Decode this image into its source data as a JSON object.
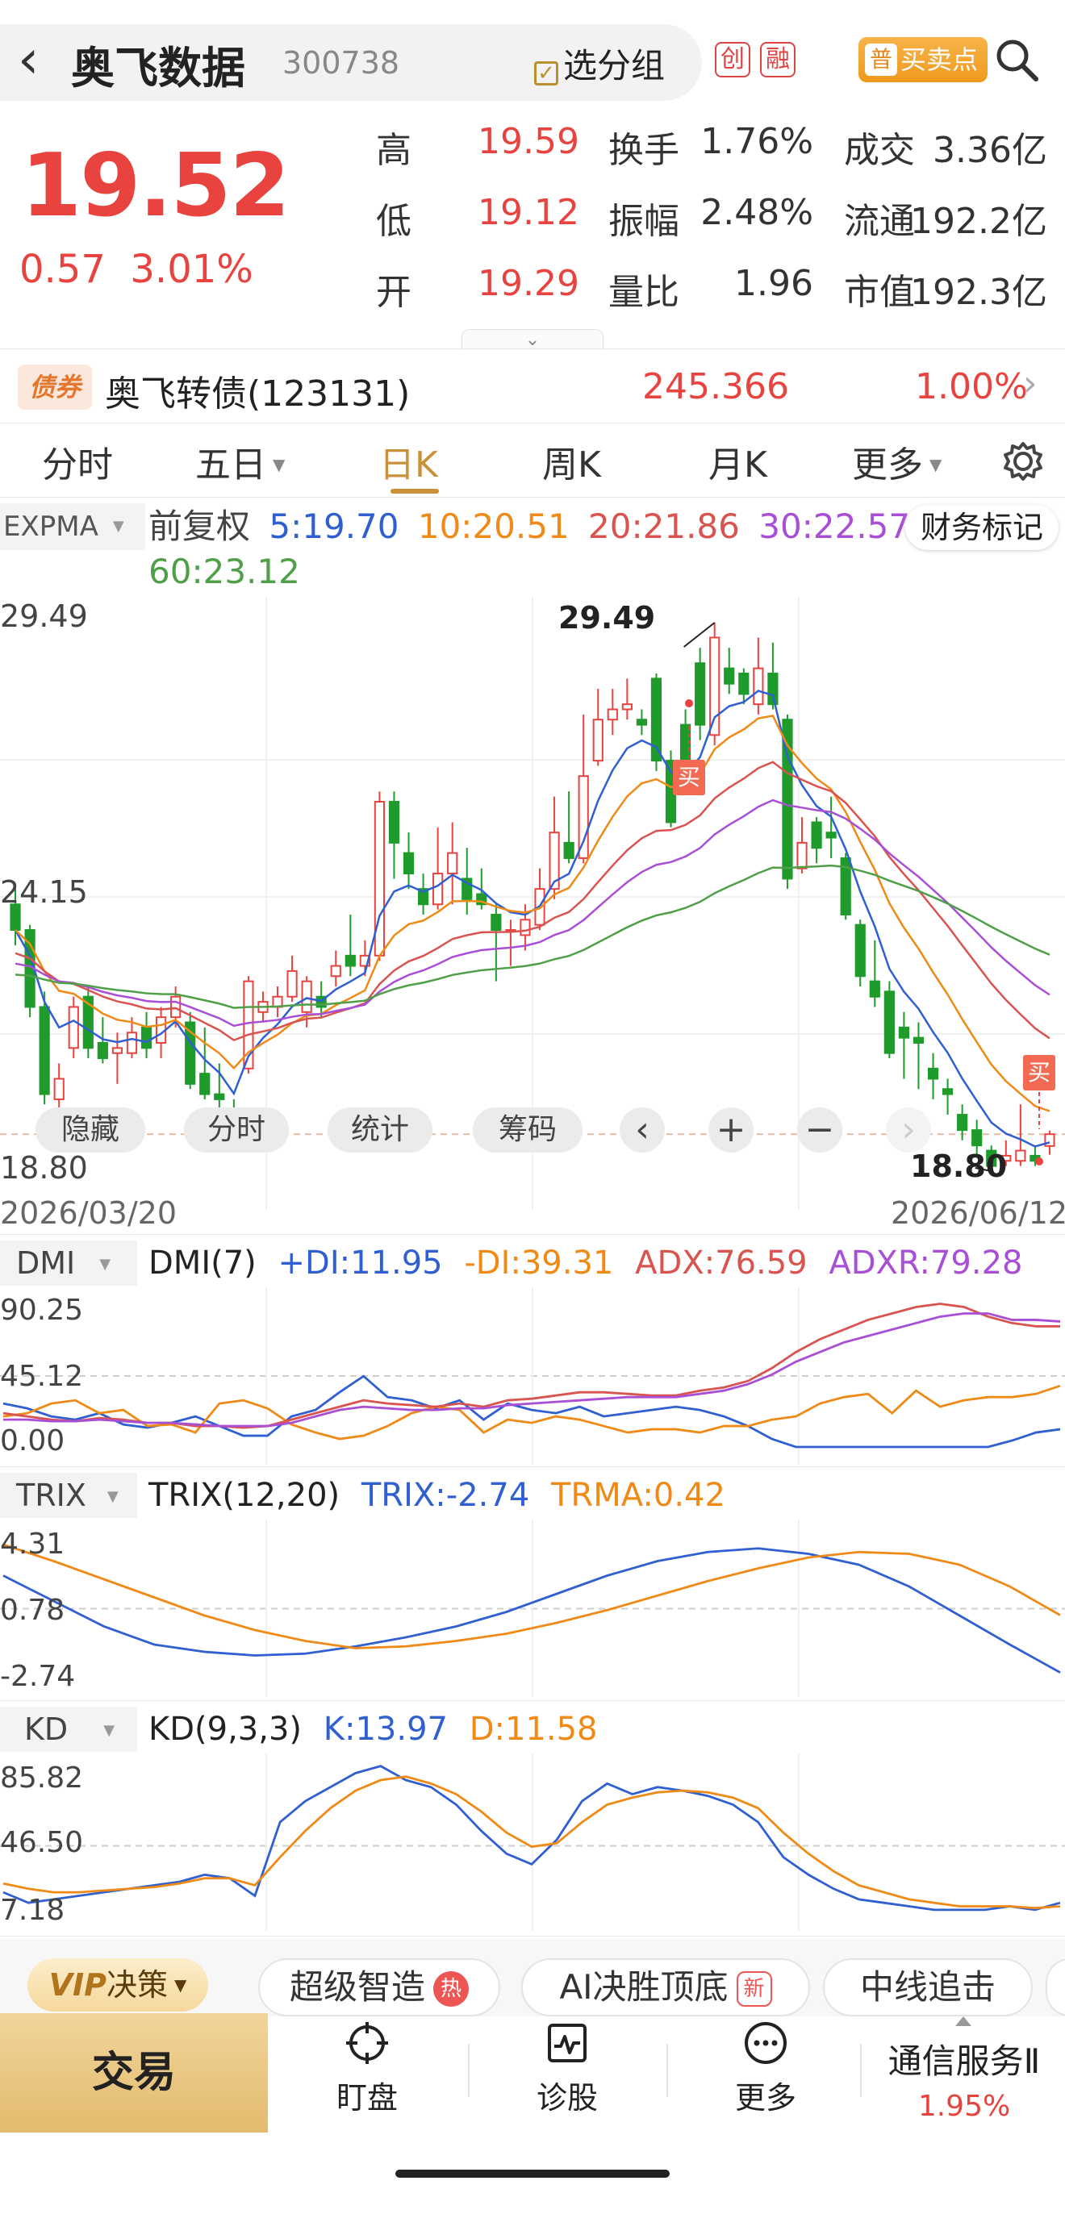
{
  "header": {
    "back": "‹",
    "name": "奥飞数据",
    "code": "300738",
    "group_btn": "选分组",
    "badge_chuang": "创",
    "badge_rong": "融",
    "maimai_tag": "普",
    "maimai": "买卖点"
  },
  "quote": {
    "price": "19.52",
    "change": "0.57",
    "change_pct": "3.01%",
    "rows": [
      {
        "l1": "高",
        "v1": "19.59",
        "l2": "换手",
        "v2": "1.76%",
        "l3": "成交",
        "v3": "3.36亿"
      },
      {
        "l1": "低",
        "v1": "19.12",
        "l2": "振幅",
        "v2": "2.48%",
        "l3": "流通",
        "v3": "192.2亿"
      },
      {
        "l1": "开",
        "v1": "19.29",
        "l2": "量比",
        "v2": "1.96",
        "l3": "市值",
        "v3": "192.3亿"
      }
    ]
  },
  "bond": {
    "tag": "债券",
    "name": "奥飞转债(123131)",
    "price": "245.366",
    "pct": "1.00%"
  },
  "tabs": [
    "分时",
    "五日",
    "日K",
    "周K",
    "月K",
    "更多"
  ],
  "ma": {
    "indicator": "EXPMA",
    "fq": "前复权",
    "m5": "5:19.70",
    "m10": "10:20.51",
    "m20": "20:21.86",
    "m30": "30:22.57",
    "m60": "60:23.12",
    "finance": "财务标记"
  },
  "kline": {
    "y_top": "29.49",
    "y_mid": "24.15",
    "y_bot": "18.80",
    "high_label": "29.49",
    "low_label": "18.80",
    "date_start": "2026/03/20",
    "date_end": "2026/06/12",
    "buy": "买"
  },
  "toolbar": {
    "hide": "隐藏",
    "fenshi": "分时",
    "stat": "统计",
    "chip": "筹码",
    "prev": "‹",
    "plus": "+",
    "minus": "−",
    "next": "›"
  },
  "dmi": {
    "name": "DMI",
    "param": "DMI(7)",
    "pdi": "+DI:11.95",
    "mdi": "-DI:39.31",
    "adx": "ADX:76.59",
    "adxr": "ADXR:79.28",
    "y1": "90.25",
    "y2": "45.12",
    "y3": "0.00"
  },
  "trix": {
    "name": "TRIX",
    "param": "TRIX(12,20)",
    "trix": "TRIX:-2.74",
    "trma": "TRMA:0.42",
    "y1": "4.31",
    "y2": "0.78",
    "y3": "-2.74"
  },
  "kd": {
    "name": "KD",
    "param": "KD(9,3,3)",
    "k": "K:13.97",
    "d": "D:11.58",
    "y1": "85.82",
    "y2": "46.50",
    "y3": "7.18"
  },
  "chips": {
    "vip": "决策",
    "vip_brand": "VIP",
    "c1": "超级智造",
    "c1_tag": "热",
    "c2": "AI决胜顶底",
    "c2_tag": "新",
    "c3": "中线追击"
  },
  "nav": {
    "trade": "交易",
    "watch": "盯盘",
    "diag": "诊股",
    "more": "更多",
    "sector": "通信服务Ⅱ",
    "sector_pct": "1.95%"
  },
  "colors": {
    "up": "#e8433f",
    "down": "#1f9b2c",
    "ma5": "#2f5fd0",
    "ma10": "#ef8a17",
    "ma20": "#d9534f",
    "ma30": "#a94fd6",
    "ma60": "#4f9f48",
    "gold": "#c9913a"
  },
  "chart_data": {
    "type": "candlestick",
    "candles": [
      [
        24.0,
        23.5,
        24.4,
        23.2
      ],
      [
        23.5,
        22.0,
        23.6,
        21.8
      ],
      [
        22.0,
        20.3,
        22.3,
        20.1
      ],
      [
        20.2,
        20.6,
        20.9,
        19.9
      ],
      [
        21.2,
        22.0,
        22.2,
        21.0
      ],
      [
        22.2,
        21.2,
        22.4,
        21.0
      ],
      [
        21.3,
        21.0,
        21.8,
        20.9
      ],
      [
        21.1,
        21.2,
        21.5,
        20.5
      ],
      [
        21.1,
        21.5,
        21.8,
        21.0
      ],
      [
        21.6,
        21.2,
        21.9,
        21.0
      ],
      [
        21.3,
        21.8,
        22.0,
        21.0
      ],
      [
        21.8,
        22.2,
        22.4,
        21.6
      ],
      [
        21.7,
        20.5,
        21.9,
        20.4
      ],
      [
        20.7,
        20.3,
        21.6,
        20.2
      ],
      [
        20.3,
        20.2,
        20.9,
        20.0
      ],
      [
        19.8,
        19.5,
        20.2,
        19.4
      ],
      [
        20.8,
        22.5,
        22.6,
        20.7
      ],
      [
        21.9,
        22.1,
        22.3,
        21.7
      ],
      [
        22.0,
        22.2,
        22.4,
        21.8
      ],
      [
        22.2,
        22.7,
        23.0,
        22.1
      ],
      [
        21.9,
        22.5,
        22.6,
        21.6
      ],
      [
        22.2,
        22.0,
        22.5,
        21.8
      ],
      [
        22.6,
        22.8,
        23.1,
        22.4
      ],
      [
        23.0,
        22.8,
        23.8,
        22.6
      ],
      [
        22.8,
        23.0,
        23.3,
        22.6
      ],
      [
        23.0,
        26.0,
        26.2,
        22.9
      ],
      [
        26.0,
        25.2,
        26.2,
        24.5
      ],
      [
        25.0,
        24.6,
        25.4,
        24.3
      ],
      [
        24.3,
        24.0,
        24.6,
        23.8
      ],
      [
        24.0,
        24.6,
        25.5,
        23.9
      ],
      [
        24.6,
        25.0,
        25.6,
        24.0
      ],
      [
        24.5,
        24.1,
        25.1,
        23.8
      ],
      [
        24.2,
        24.0,
        24.7,
        23.9
      ],
      [
        23.8,
        23.5,
        24.0,
        22.5
      ],
      [
        23.5,
        23.5,
        23.7,
        22.8
      ],
      [
        23.4,
        23.7,
        24.0,
        23.1
      ],
      [
        23.6,
        24.3,
        24.7,
        23.5
      ],
      [
        24.3,
        25.4,
        26.1,
        24.1
      ],
      [
        25.2,
        24.9,
        26.2,
        24.8
      ],
      [
        24.9,
        26.5,
        27.7,
        24.8
      ],
      [
        26.8,
        27.6,
        28.2,
        26.7
      ],
      [
        27.6,
        27.8,
        28.2,
        27.3
      ],
      [
        27.8,
        27.9,
        28.4,
        27.6
      ],
      [
        27.6,
        27.5,
        27.8,
        27.3
      ],
      [
        28.4,
        26.8,
        28.5,
        26.6
      ],
      [
        26.8,
        25.6,
        27.0,
        25.5
      ],
      [
        27.5,
        26.5,
        27.8,
        26.3
      ],
      [
        28.7,
        27.5,
        29.0,
        27.2
      ],
      [
        27.3,
        29.2,
        29.49,
        27.1
      ],
      [
        28.6,
        28.3,
        29.0,
        28.1
      ],
      [
        28.5,
        28.1,
        28.6,
        27.9
      ],
      [
        27.9,
        28.6,
        29.2,
        27.7
      ],
      [
        28.5,
        27.9,
        29.1,
        27.8
      ],
      [
        27.6,
        24.5,
        27.7,
        24.3
      ],
      [
        24.7,
        25.2,
        25.7,
        24.6
      ],
      [
        25.6,
        25.1,
        25.7,
        24.8
      ],
      [
        25.4,
        25.3,
        26.1,
        24.9
      ],
      [
        24.9,
        23.8,
        25.0,
        23.7
      ],
      [
        23.6,
        22.6,
        23.7,
        22.4
      ],
      [
        22.5,
        22.2,
        23.3,
        22.0
      ],
      [
        22.3,
        21.1,
        22.5,
        21.0
      ],
      [
        21.6,
        21.4,
        21.9,
        20.6
      ],
      [
        21.4,
        21.3,
        21.7,
        20.4
      ],
      [
        20.8,
        20.6,
        21.1,
        20.2
      ],
      [
        20.4,
        20.3,
        20.6,
        19.9
      ],
      [
        19.9,
        19.6,
        20.1,
        19.4
      ],
      [
        19.6,
        19.3,
        19.8,
        19.1
      ],
      [
        19.2,
        18.9,
        19.3,
        18.8
      ],
      [
        19.0,
        19.1,
        19.4,
        18.9
      ],
      [
        19.0,
        19.2,
        20.1,
        18.9
      ],
      [
        19.1,
        19.0,
        19.3,
        18.9
      ],
      [
        19.29,
        19.52,
        19.59,
        19.12
      ]
    ],
    "ma5": {
      "name": "5",
      "value": 19.7
    },
    "ma10": {
      "name": "10",
      "value": 20.51
    },
    "ma20": {
      "name": "20",
      "value": 21.86
    },
    "ma30": {
      "name": "30",
      "value": 22.57
    },
    "ma60": {
      "name": "60",
      "value": 23.12
    },
    "y_range": [
      18.8,
      29.49
    ]
  }
}
